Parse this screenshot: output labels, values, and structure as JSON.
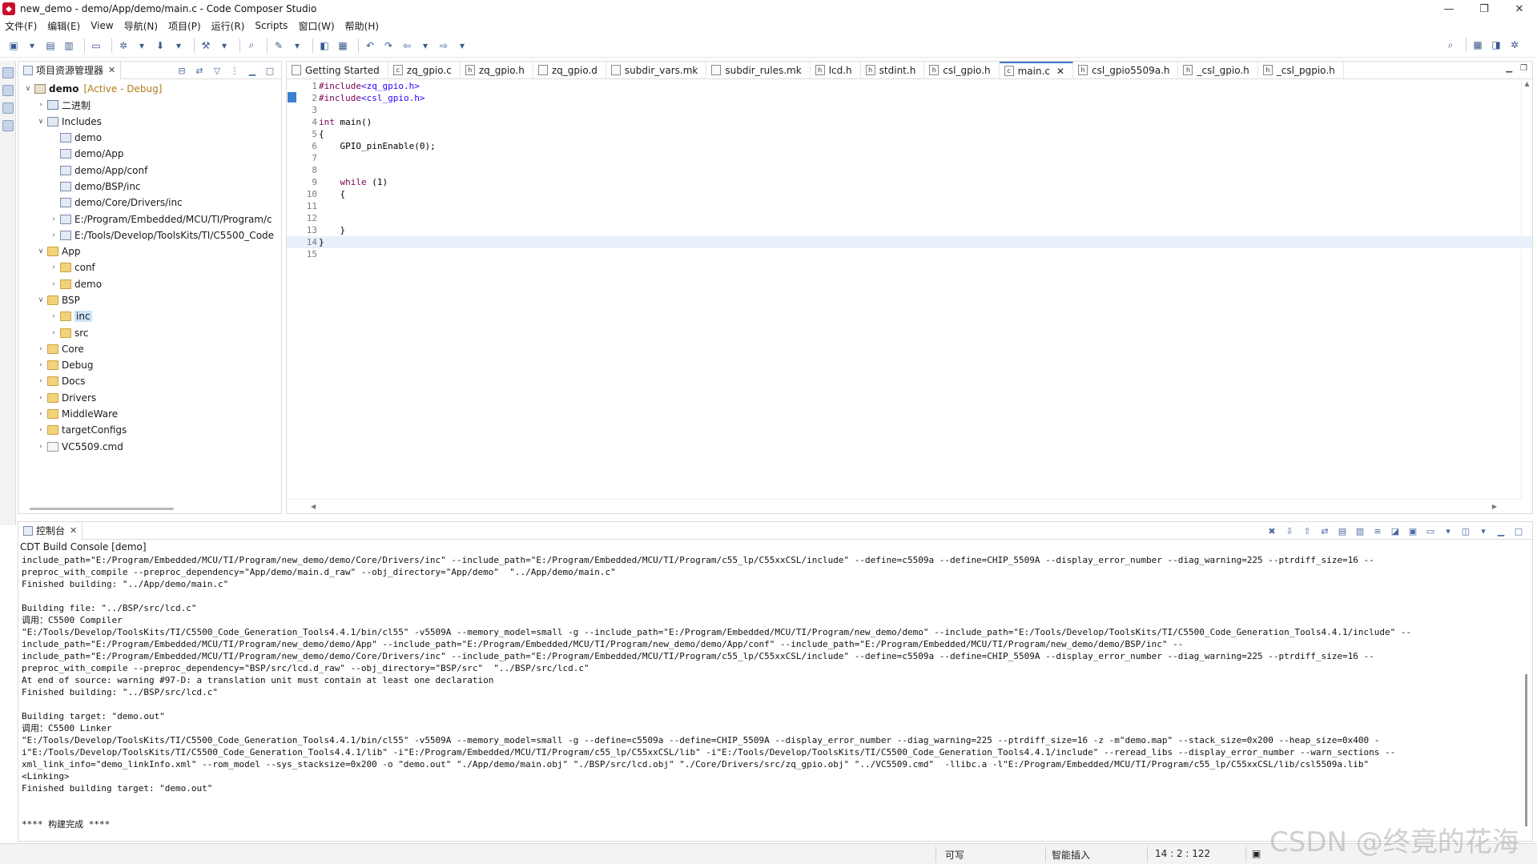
{
  "window": {
    "title": "new_demo - demo/App/demo/main.c - Code Composer Studio",
    "controls": {
      "minimize": "—",
      "restore": "❐",
      "close": "✕"
    }
  },
  "menu": [
    "文件(F)",
    "编辑(E)",
    "View",
    "导航(N)",
    "项目(P)",
    "运行(R)",
    "Scripts",
    "窗口(W)",
    "帮助(H)"
  ],
  "explorer": {
    "tab_label": "项目资源管理器",
    "tree": [
      {
        "label": "demo",
        "suffix": "[Active - Debug]",
        "icon": "project-icon",
        "twisty": "expanded",
        "indent": 0
      },
      {
        "label": "二进制",
        "icon": "binaries-icon",
        "twisty": "collapsed",
        "indent": 1
      },
      {
        "label": "Includes",
        "icon": "includes-icon",
        "twisty": "expanded",
        "indent": 1
      },
      {
        "label": "demo",
        "icon": "include-folder-icon",
        "twisty": "none",
        "indent": 2
      },
      {
        "label": "demo/App",
        "icon": "include-folder-icon",
        "twisty": "none",
        "indent": 2
      },
      {
        "label": "demo/App/conf",
        "icon": "include-folder-icon",
        "twisty": "none",
        "indent": 2
      },
      {
        "label": "demo/BSP/inc",
        "icon": "include-folder-icon",
        "twisty": "none",
        "indent": 2
      },
      {
        "label": "demo/Core/Drivers/inc",
        "icon": "include-folder-icon",
        "twisty": "none",
        "indent": 2
      },
      {
        "label": "E:/Program/Embedded/MCU/TI/Program/c",
        "icon": "include-folder-icon",
        "twisty": "collapsed",
        "indent": 2
      },
      {
        "label": "E:/Tools/Develop/ToolsKits/TI/C5500_Code",
        "icon": "include-folder-icon",
        "twisty": "collapsed",
        "indent": 2
      },
      {
        "label": "App",
        "icon": "folder-icon",
        "twisty": "expanded",
        "indent": 1
      },
      {
        "label": "conf",
        "icon": "folder-icon",
        "twisty": "collapsed",
        "indent": 2
      },
      {
        "label": "demo",
        "icon": "folder-icon",
        "twisty": "collapsed",
        "indent": 2
      },
      {
        "label": "BSP",
        "icon": "folder-icon",
        "twisty": "expanded",
        "indent": 1
      },
      {
        "label": "inc",
        "icon": "folder-icon",
        "twisty": "collapsed",
        "indent": 2,
        "selected": true
      },
      {
        "label": "src",
        "icon": "folder-icon",
        "twisty": "collapsed",
        "indent": 2
      },
      {
        "label": "Core",
        "icon": "folder-icon",
        "twisty": "collapsed",
        "indent": 1
      },
      {
        "label": "Debug",
        "icon": "folder-icon",
        "twisty": "collapsed",
        "indent": 1
      },
      {
        "label": "Docs",
        "icon": "folder-icon",
        "twisty": "collapsed",
        "indent": 1
      },
      {
        "label": "Drivers",
        "icon": "folder-icon",
        "twisty": "collapsed",
        "indent": 1
      },
      {
        "label": "MiddleWare",
        "icon": "folder-icon",
        "twisty": "collapsed",
        "indent": 1
      },
      {
        "label": "targetConfigs",
        "icon": "folder-icon",
        "twisty": "collapsed",
        "indent": 1
      },
      {
        "label": "VC5509.cmd",
        "icon": "file-icon",
        "twisty": "collapsed",
        "indent": 1
      }
    ]
  },
  "editor": {
    "tabs": [
      {
        "label": "Getting Started",
        "icon": "page-icon"
      },
      {
        "label": "zq_gpio.c",
        "icon": "c-file-icon"
      },
      {
        "label": "zq_gpio.h",
        "icon": "h-file-icon"
      },
      {
        "label": "zq_gpio.d",
        "icon": "file-icon"
      },
      {
        "label": "subdir_vars.mk",
        "icon": "make-file-icon"
      },
      {
        "label": "subdir_rules.mk",
        "icon": "make-file-icon"
      },
      {
        "label": "lcd.h",
        "icon": "h-file-icon"
      },
      {
        "label": "stdint.h",
        "icon": "h-file-icon"
      },
      {
        "label": "csl_gpio.h",
        "icon": "h-file-icon"
      },
      {
        "label": "main.c",
        "icon": "c-file-icon",
        "active": true
      },
      {
        "label": "csl_gpio5509a.h",
        "icon": "h-file-icon"
      },
      {
        "label": "_csl_gpio.h",
        "icon": "h-file-icon"
      },
      {
        "label": "_csl_pgpio.h",
        "icon": "h-file-icon"
      }
    ],
    "lines": [
      {
        "n": "1",
        "parts": [
          [
            "pp",
            "#include"
          ],
          [
            "str",
            "<zq_gpio.h>"
          ]
        ]
      },
      {
        "n": "2",
        "parts": [
          [
            "pp",
            "#include"
          ],
          [
            "str",
            "<csl_gpio.h>"
          ]
        ]
      },
      {
        "n": "3",
        "parts": []
      },
      {
        "n": "4",
        "parts": [
          [
            "kw",
            "int"
          ],
          [
            "src",
            " main()"
          ]
        ]
      },
      {
        "n": "5",
        "parts": [
          [
            "src",
            "{"
          ]
        ]
      },
      {
        "n": "6",
        "parts": [
          [
            "src",
            "    GPIO_pinEnable(0);"
          ]
        ]
      },
      {
        "n": "7",
        "parts": []
      },
      {
        "n": "8",
        "parts": []
      },
      {
        "n": "9",
        "parts": [
          [
            "kw",
            "    while"
          ],
          [
            "src",
            " (1)"
          ]
        ]
      },
      {
        "n": "10",
        "parts": [
          [
            "src",
            "    {"
          ]
        ]
      },
      {
        "n": "11",
        "parts": []
      },
      {
        "n": "12",
        "parts": []
      },
      {
        "n": "13",
        "parts": [
          [
            "src",
            "    }"
          ]
        ]
      },
      {
        "n": "14",
        "parts": [
          [
            "src",
            "}"
          ]
        ],
        "current": true
      },
      {
        "n": "15",
        "parts": []
      }
    ]
  },
  "console": {
    "tab_label": "控制台",
    "title": "CDT Build Console [demo]",
    "text": "include_path=\"E:/Program/Embedded/MCU/TI/Program/new_demo/demo/Core/Drivers/inc\" --include_path=\"E:/Program/Embedded/MCU/TI/Program/c55_lp/C55xxCSL/include\" --define=c5509a --define=CHIP_5509A --display_error_number --diag_warning=225 --ptrdiff_size=16 --\npreproc_with_compile --preproc_dependency=\"App/demo/main.d_raw\" --obj_directory=\"App/demo\"  \"../App/demo/main.c\"\nFinished building: \"../App/demo/main.c\"\n\nBuilding file: \"../BSP/src/lcd.c\"\n调用：C5500 Compiler\n\"E:/Tools/Develop/ToolsKits/TI/C5500_Code_Generation_Tools4.4.1/bin/cl55\" -v5509A --memory_model=small -g --include_path=\"E:/Program/Embedded/MCU/TI/Program/new_demo/demo\" --include_path=\"E:/Tools/Develop/ToolsKits/TI/C5500_Code_Generation_Tools4.4.1/include\" --\ninclude_path=\"E:/Program/Embedded/MCU/TI/Program/new_demo/demo/App\" --include_path=\"E:/Program/Embedded/MCU/TI/Program/new_demo/demo/App/conf\" --include_path=\"E:/Program/Embedded/MCU/TI/Program/new_demo/demo/BSP/inc\" --\ninclude_path=\"E:/Program/Embedded/MCU/TI/Program/new_demo/demo/Core/Drivers/inc\" --include_path=\"E:/Program/Embedded/MCU/TI/Program/c55_lp/C55xxCSL/include\" --define=c5509a --define=CHIP_5509A --display_error_number --diag_warning=225 --ptrdiff_size=16 --\npreproc_with_compile --preproc_dependency=\"BSP/src/lcd.d_raw\" --obj_directory=\"BSP/src\"  \"../BSP/src/lcd.c\"\nAt end of source: warning #97-D: a translation unit must contain at least one declaration\nFinished building: \"../BSP/src/lcd.c\"\n\nBuilding target: \"demo.out\"\n调用：C5500 Linker\n\"E:/Tools/Develop/ToolsKits/TI/C5500_Code_Generation_Tools4.4.1/bin/cl55\" -v5509A --memory_model=small -g --define=c5509a --define=CHIP_5509A --display_error_number --diag_warning=225 --ptrdiff_size=16 -z -m\"demo.map\" --stack_size=0x200 --heap_size=0x400 -\ni\"E:/Tools/Develop/ToolsKits/TI/C5500_Code_Generation_Tools4.4.1/lib\" -i\"E:/Program/Embedded/MCU/TI/Program/c55_lp/C55xxCSL/lib\" -i\"E:/Tools/Develop/ToolsKits/TI/C5500_Code_Generation_Tools4.4.1/include\" --reread_libs --display_error_number --warn_sections --\nxml_link_info=\"demo_linkInfo.xml\" --rom_model --sys_stacksize=0x200 -o \"demo.out\" \"./App/demo/main.obj\" \"./BSP/src/lcd.obj\" \"./Core/Drivers/src/zq_gpio.obj\" \"../VC5509.cmd\"  -llibc.a -l\"E:/Program/Embedded/MCU/TI/Program/c55_lp/C55xxCSL/lib/csl5509a.lib\"\n<Linking>\nFinished building target: \"demo.out\"\n\n\n**** 构建完成 ****"
  },
  "status": {
    "writable": "可写",
    "insert_mode": "智能插入",
    "position": "14 : 2 : 122"
  },
  "watermark": "CSDN @终竟的花海",
  "colors": {
    "accent": "#3c78c8",
    "active_project": "#b07c1c",
    "keyword": "#7f0055",
    "string": "#2a00ff"
  }
}
